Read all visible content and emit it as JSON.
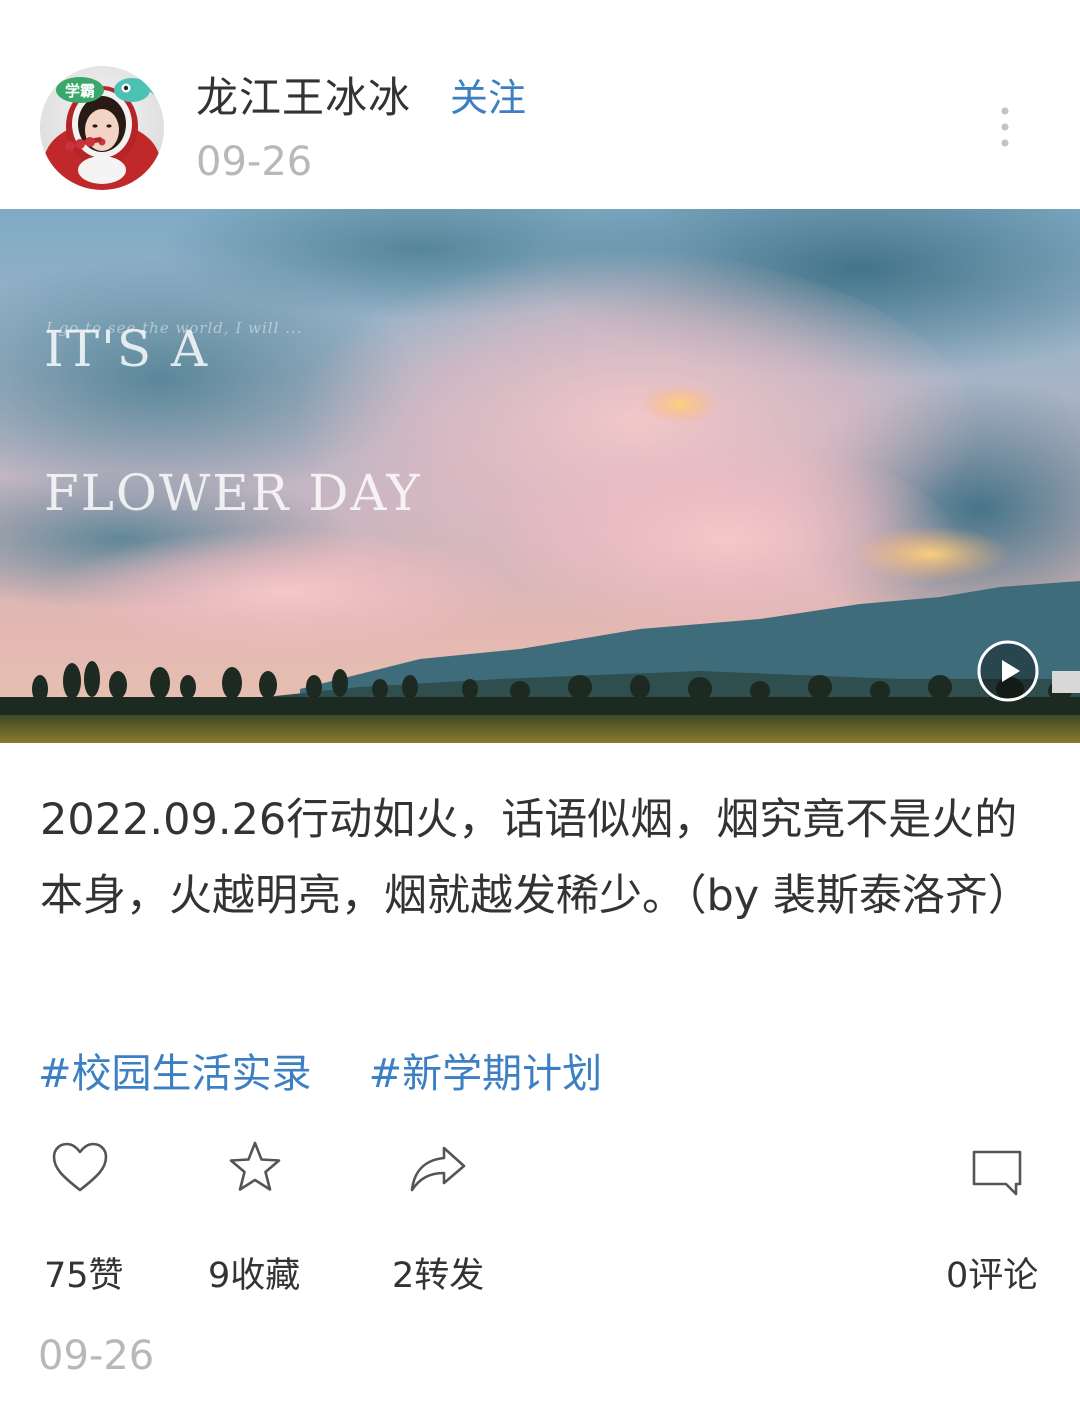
{
  "header": {
    "username": "龙江王冰冰",
    "follow_label": "关注",
    "date": "09-26",
    "avatar_badge": "学霸"
  },
  "media": {
    "overlay_title_line1": "IT'S A",
    "overlay_title_line2": "FLOWER DAY",
    "overlay_subtitle": "I go to see the world, I will ..."
  },
  "post": {
    "text": "2022.09.26行动如火，话语似烟，烟究竟不是火的本身，火越明亮，烟就越发稀少。（by 裴斯泰洛齐）",
    "tags": [
      "#校园生活实录",
      "#新学期计划"
    ]
  },
  "actions": {
    "like_label": "75赞",
    "favorite_label": "9收藏",
    "share_label": "2转发",
    "comment_label": "0评论"
  },
  "footer": {
    "date": "09-26"
  },
  "colors": {
    "accent": "#3d7fc3",
    "muted": "#b8b8b8",
    "text": "#333333"
  }
}
